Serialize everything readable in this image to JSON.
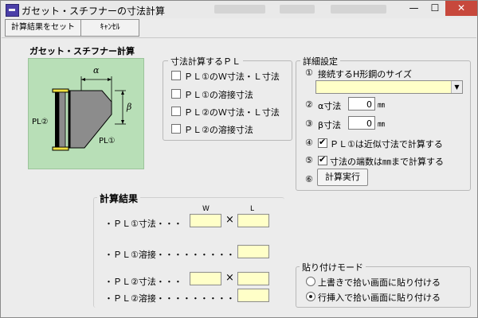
{
  "window": {
    "title": "ガセット・スチフナーの寸法計算",
    "min": "—",
    "max": "☐",
    "close": "✕"
  },
  "toolbar": {
    "set_result": "計算結果をセット",
    "cancel": "ｷｬﾝｾﾙ"
  },
  "diagram": {
    "title": "ガセット・スチフナー計算",
    "alpha": "α",
    "beta": "β",
    "pl1": "PL①",
    "pl2": "PL②"
  },
  "dimension_calc": {
    "legend": "寸法計算するＰＬ",
    "items": [
      {
        "label": "ＰＬ①のＷ寸法・Ｌ寸法",
        "checked": false
      },
      {
        "label": "ＰＬ①の溶接寸法",
        "checked": false
      },
      {
        "label": "ＰＬ②のＷ寸法・Ｌ寸法",
        "checked": false
      },
      {
        "label": "ＰＬ②の溶接寸法",
        "checked": false
      }
    ]
  },
  "details": {
    "legend": "詳細設定",
    "row1": {
      "num": "①",
      "label": "接続するH形鋼のサイズ",
      "value": ""
    },
    "row2": {
      "num": "②",
      "label": "α寸法",
      "value": "0",
      "unit": "㎜"
    },
    "row3": {
      "num": "③",
      "label": "β寸法",
      "value": "0",
      "unit": "㎜"
    },
    "row4": {
      "num": "④",
      "label": "ＰＬ①は近似寸法で計算する",
      "checked": true
    },
    "row5": {
      "num": "⑤",
      "label": "寸法の端数は㎜まで計算する",
      "checked": true
    },
    "row6": {
      "num": "⑥",
      "button": "計算実行"
    }
  },
  "results": {
    "title": "計算結果",
    "col_w": "W",
    "col_l": "L",
    "times": "×",
    "rows": [
      {
        "label": "・ＰＬ①寸法・・・"
      },
      {
        "label": "・ＰＬ①溶接・・・・・・・・・・・・"
      },
      {
        "label": "・ＰＬ②寸法・・・"
      },
      {
        "label": "・ＰＬ②溶接・・・・・・・・・・・・"
      }
    ]
  },
  "paste_mode": {
    "legend": "貼り付けモード",
    "options": [
      {
        "label": "上書きで拾い画面に貼り付ける",
        "selected": false
      },
      {
        "label": "行挿入で拾い画面に貼り付ける",
        "selected": true
      }
    ]
  }
}
